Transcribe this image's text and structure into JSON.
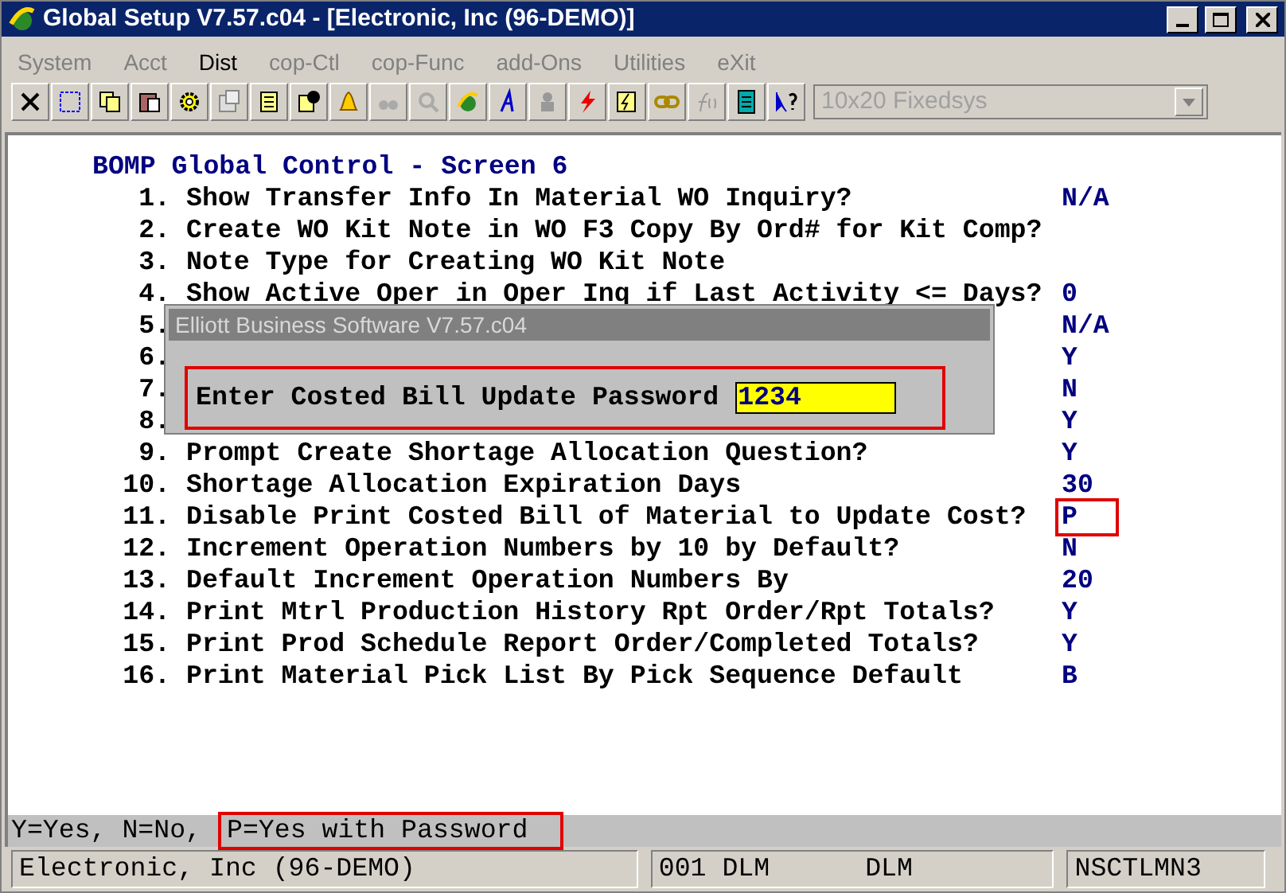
{
  "window": {
    "title": "Global Setup V7.57.c04 - [Electronic, Inc (96-DEMO)]"
  },
  "menu": [
    {
      "label": "System",
      "disabled": true
    },
    {
      "label": "Acct",
      "disabled": true
    },
    {
      "label": "Dist",
      "disabled": false
    },
    {
      "label": "cop-Ctl",
      "disabled": true
    },
    {
      "label": "cop-Func",
      "disabled": true
    },
    {
      "label": "add-Ons",
      "disabled": true
    },
    {
      "label": "Utilities",
      "disabled": true
    },
    {
      "label": "eXit",
      "disabled": true
    }
  ],
  "toolbar": {
    "font_select": {
      "value": "10x20 Fixedsys",
      "disabled": true
    }
  },
  "screen": {
    "title": "BOMP Global Control - Screen 6",
    "rows": [
      {
        "number": "1.",
        "label": "Show Transfer Info In Material WO Inquiry?",
        "value": "N/A",
        "highlighted": false
      },
      {
        "number": "2.",
        "label": "Create WO Kit Note in WO F3 Copy By Ord# for Kit Comp?",
        "value": "",
        "highlighted": false
      },
      {
        "number": "3.",
        "label": "Note Type for Creating WO Kit Note",
        "value": "",
        "highlighted": false
      },
      {
        "number": "4.",
        "label": "Show Active Oper in Oper Inq if Last Activity <= Days?",
        "value": "0",
        "highlighted": false
      },
      {
        "number": "5.",
        "label": "",
        "value": "N/A",
        "highlighted": false
      },
      {
        "number": "6.",
        "label": "",
        "value": "Y",
        "highlighted": false
      },
      {
        "number": "7.",
        "label": "",
        "value": "N",
        "highlighted": false
      },
      {
        "number": "8.",
        "label": "",
        "value": "Y",
        "highlighted": false
      },
      {
        "number": "9.",
        "label": "Prompt Create Shortage Allocation Question?",
        "value": "Y",
        "highlighted": false
      },
      {
        "number": "10.",
        "label": "Shortage Allocation Expiration Days",
        "value": "30",
        "highlighted": false
      },
      {
        "number": "11.",
        "label": "Disable Print Costed Bill of Material to Update Cost?",
        "value": "P",
        "highlighted": true
      },
      {
        "number": "12.",
        "label": "Increment Operation Numbers by 10 by Default?",
        "value": "N",
        "highlighted": false
      },
      {
        "number": "13.",
        "label": "Default Increment Operation Numbers By",
        "value": "20",
        "highlighted": false
      },
      {
        "number": "14.",
        "label": "Print Mtrl Production History Rpt Order/Rpt Totals?",
        "value": "Y",
        "highlighted": false
      },
      {
        "number": "15.",
        "label": "Print Prod Schedule Report Order/Completed Totals?",
        "value": "Y",
        "highlighted": false
      },
      {
        "number": "16.",
        "label": "Print Material Pick List By Pick Sequence Default",
        "value": "B",
        "highlighted": false
      }
    ]
  },
  "dialog": {
    "title": "Elliott Business Software V7.57.c04",
    "prompt": "Enter Costed Bill Update Password",
    "value": "1234",
    "highlighted": true
  },
  "hint_line": [
    {
      "text": "Y=Yes, N=No,",
      "highlighted": false
    },
    {
      "text": "P=Yes with Password",
      "highlighted": true
    }
  ],
  "status_bar": [
    "Electronic, Inc (96-DEMO)",
    "001 DLM",
    "DLM",
    "NSCTLMN3"
  ]
}
